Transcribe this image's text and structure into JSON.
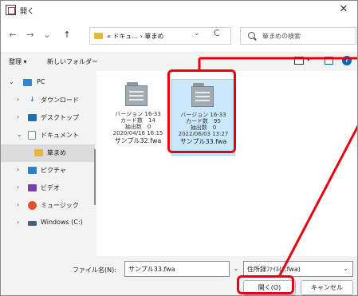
{
  "window": {
    "title": "開く",
    "close": "✕"
  },
  "nav": {
    "back": "←",
    "forward": "→",
    "recent": "⌄",
    "up": "↑",
    "address": "« ドキュ... › 箪まめ",
    "address_dropdown": "⌄",
    "refresh": "C",
    "search_placeholder": "箪まめの検索"
  },
  "toolbar": {
    "organize": "整理 ▾",
    "new_folder": "新しいフォルダー"
  },
  "sidebar": {
    "items": [
      {
        "label": "PC",
        "chevron": "⌄",
        "icon": "pc-icon",
        "color": "#2b88d8"
      },
      {
        "label": "ダウンロード",
        "chevron": "›",
        "icon": "download-icon",
        "color": "#1f78c1"
      },
      {
        "label": "デスクトップ",
        "chevron": "›",
        "icon": "desktop-icon",
        "color": "#1f6fb5"
      },
      {
        "label": "ドキュメント",
        "chevron": "⌄",
        "icon": "documents-icon",
        "color": "#7d8b99"
      },
      {
        "label": "箪まめ",
        "chevron": "",
        "icon": "folder-icon",
        "color": "#e8b83a"
      },
      {
        "label": "ピクチャ",
        "chevron": "›",
        "icon": "pictures-icon",
        "color": "#2f7fd1"
      },
      {
        "label": "ビデオ",
        "chevron": "›",
        "icon": "videos-icon",
        "color": "#7a3fb0"
      },
      {
        "label": "ミュージック",
        "chevron": "›",
        "icon": "music-icon",
        "color": "#e0522d"
      },
      {
        "label": "Windows (C:)",
        "chevron": "›",
        "icon": "drive-icon",
        "color": "#4a6078"
      }
    ],
    "selected_index": 4
  },
  "files": [
    {
      "info": [
        "バージョン 16-33",
        "カード数　14",
        "抽出数　0",
        "2020/04/16 16:15"
      ],
      "name": "サンプル32.fwa",
      "selected": false
    },
    {
      "info": [
        "バージョン 16-33",
        "カード数　95",
        "抽出数　0",
        "2022/06/03 13:27"
      ],
      "name": "サンプル33.fwa",
      "selected": true
    }
  ],
  "bottom": {
    "filename_label": "ファイル名(N):",
    "filename_value": "サンプル33.fwa",
    "filetype_value": "住所録ﾌｧｲﾙ(*.fwa)",
    "open_label": "開く(O)",
    "cancel_label": "キャンセル"
  },
  "colors": {
    "accent": "#0067c0",
    "annotation": "#e60012",
    "selected_file": "#cce8ff"
  }
}
